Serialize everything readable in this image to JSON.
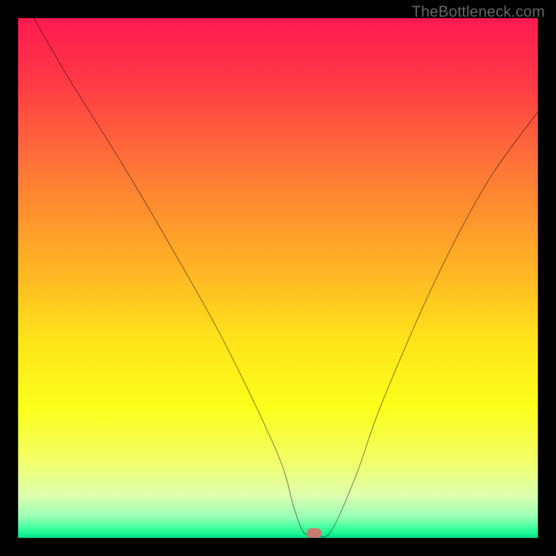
{
  "watermark": "TheBottleneck.com",
  "chart_data": {
    "type": "line",
    "title": "",
    "xlabel": "",
    "ylabel": "",
    "xlim": [
      0,
      100
    ],
    "ylim": [
      0,
      100
    ],
    "grid": false,
    "legend": false,
    "series": [
      {
        "name": "bottleneck-curve",
        "x": [
          3,
          10,
          20,
          30,
          40,
          50,
          53,
          55,
          57,
          60,
          65,
          70,
          80,
          90,
          100
        ],
        "values": [
          100,
          88,
          72,
          55,
          37,
          16,
          6,
          1,
          1,
          1,
          12,
          26,
          49,
          68,
          82
        ]
      }
    ],
    "marker": {
      "x": 57,
      "y": 1,
      "color": "#cb7a70"
    },
    "background_gradient": {
      "stops": [
        {
          "pos": 0.0,
          "color": "#ff1a50"
        },
        {
          "pos": 0.12,
          "color": "#ff3846"
        },
        {
          "pos": 0.3,
          "color": "#ff7a35"
        },
        {
          "pos": 0.48,
          "color": "#ffb325"
        },
        {
          "pos": 0.62,
          "color": "#ffe41a"
        },
        {
          "pos": 0.75,
          "color": "#fbff1a"
        },
        {
          "pos": 0.85,
          "color": "#f3ff66"
        },
        {
          "pos": 0.92,
          "color": "#dcffb0"
        },
        {
          "pos": 0.96,
          "color": "#96ffb4"
        },
        {
          "pos": 0.985,
          "color": "#2eff99"
        },
        {
          "pos": 1.0,
          "color": "#00e58a"
        }
      ]
    }
  }
}
